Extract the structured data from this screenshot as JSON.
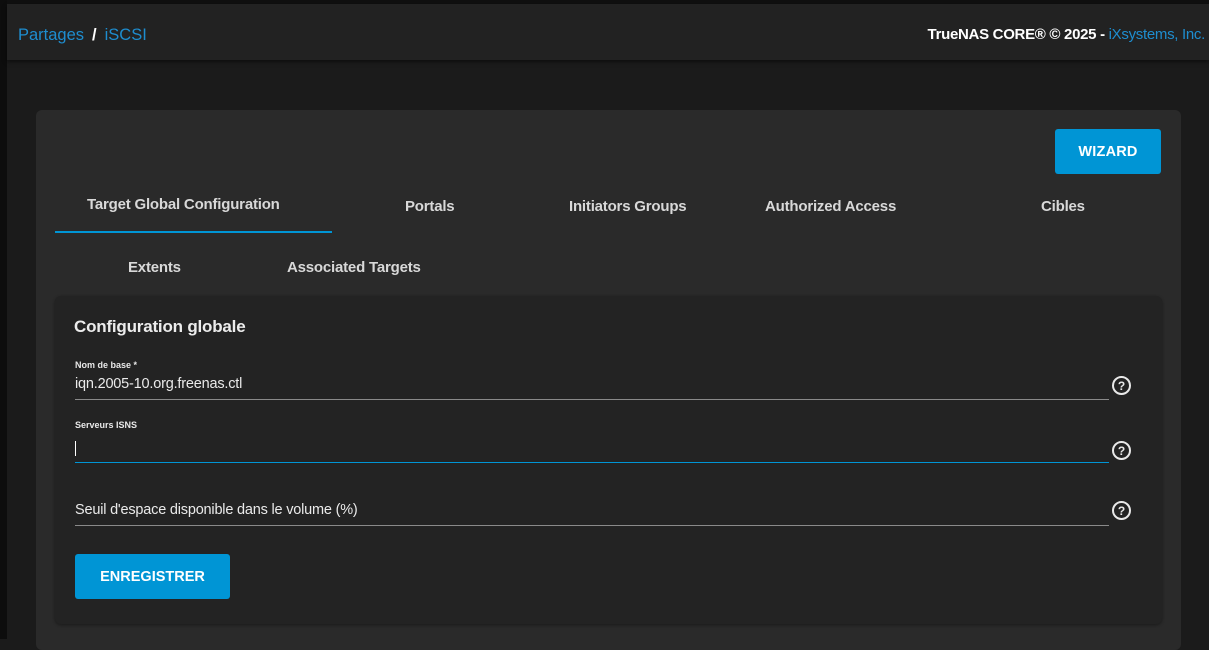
{
  "header": {
    "breadcrumb": [
      "Partages",
      "iSCSI"
    ],
    "breadcrumb_separator": "/",
    "copyright_text": "TrueNAS CORE® © 2025 - ",
    "copyright_link": "iXsystems, Inc."
  },
  "toolbar": {
    "wizard_label": "WIZARD"
  },
  "tabs": [
    {
      "label": "Target Global Configuration",
      "active": true
    },
    {
      "label": "Portals",
      "active": false
    },
    {
      "label": "Initiators Groups",
      "active": false
    },
    {
      "label": "Authorized Access",
      "active": false
    },
    {
      "label": "Cibles",
      "active": false
    },
    {
      "label": "Extents",
      "active": false
    },
    {
      "label": "Associated Targets",
      "active": false
    }
  ],
  "form": {
    "title": "Configuration globale",
    "fields": [
      {
        "label": "Nom de base *",
        "value": "iqn.2005-10.org.freenas.ctl",
        "help_icon": "help-circle-icon"
      },
      {
        "label": "Serveurs ISNS",
        "value": "",
        "focused": true,
        "help_icon": "help-circle-icon"
      },
      {
        "label": "Seuil d'espace disponible dans le volume (%)",
        "value": "",
        "help_icon": "help-circle-icon"
      }
    ],
    "save_label": "ENREGISTRER"
  },
  "colors": {
    "accent": "#0095d5",
    "link": "#1e8dcf",
    "background": "#1b1b1b",
    "card": "#2a2a2a"
  }
}
